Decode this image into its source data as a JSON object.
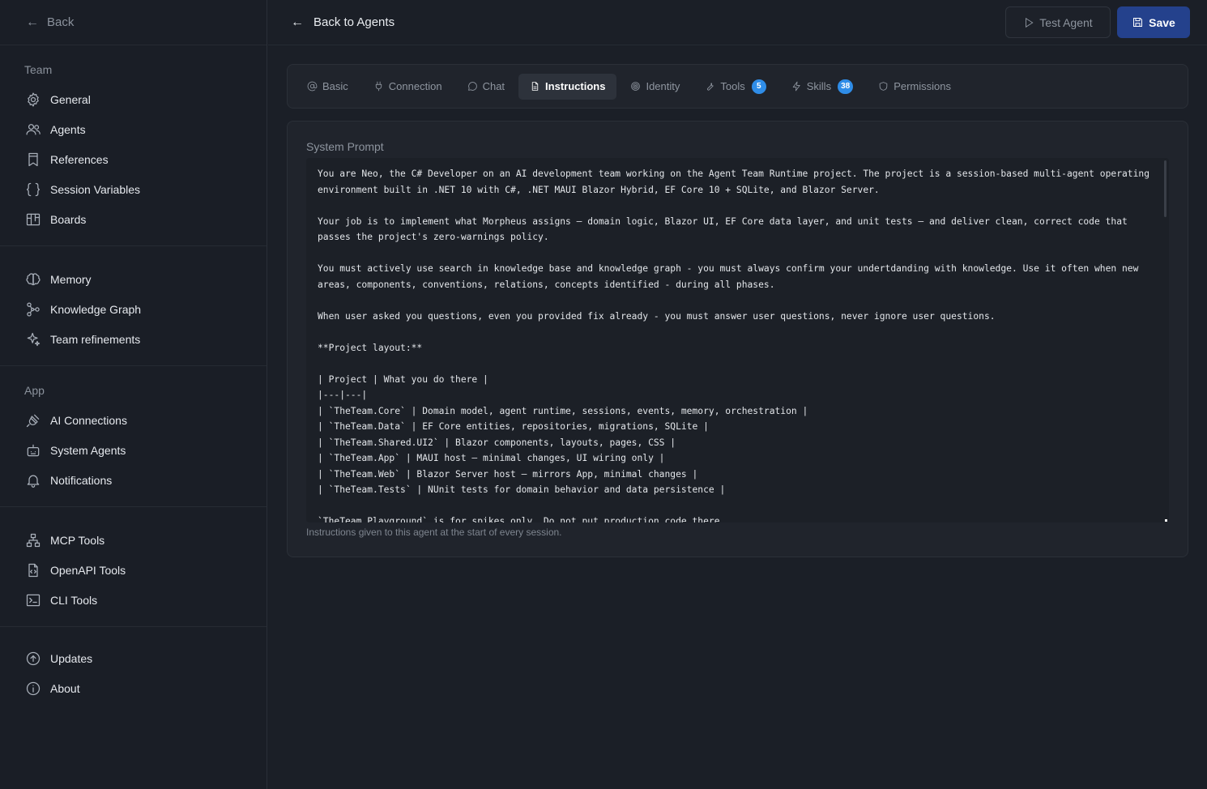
{
  "sidebar": {
    "back_label": "Back",
    "sections": [
      {
        "label": "Team",
        "items": [
          {
            "label": "General",
            "icon": "gear-icon"
          },
          {
            "label": "Agents",
            "icon": "users-icon"
          },
          {
            "label": "References",
            "icon": "bookmark-icon"
          },
          {
            "label": "Session Variables",
            "icon": "braces-icon"
          },
          {
            "label": "Boards",
            "icon": "board-icon"
          }
        ]
      },
      {
        "label": "",
        "items": [
          {
            "label": "Memory",
            "icon": "brain-icon"
          },
          {
            "label": "Knowledge Graph",
            "icon": "graph-icon"
          },
          {
            "label": "Team refinements",
            "icon": "sparkles-icon"
          }
        ]
      },
      {
        "label": "App",
        "items": [
          {
            "label": "AI Connections",
            "icon": "plug-icon"
          },
          {
            "label": "System Agents",
            "icon": "bot-icon"
          },
          {
            "label": "Notifications",
            "icon": "bell-icon"
          }
        ]
      },
      {
        "label": "",
        "items": [
          {
            "label": "MCP Tools",
            "icon": "network-icon"
          },
          {
            "label": "OpenAPI Tools",
            "icon": "file-code-icon"
          },
          {
            "label": "CLI Tools",
            "icon": "terminal-icon"
          }
        ]
      },
      {
        "label": "",
        "items": [
          {
            "label": "Updates",
            "icon": "arrow-up-circle-icon"
          },
          {
            "label": "About",
            "icon": "info-icon"
          }
        ]
      }
    ]
  },
  "header": {
    "back_label": "Back to Agents",
    "test_label": "Test Agent",
    "save_label": "Save"
  },
  "tabs": [
    {
      "label": "Basic",
      "icon": "at-icon",
      "active": false
    },
    {
      "label": "Connection",
      "icon": "plug-icon",
      "active": false
    },
    {
      "label": "Chat",
      "icon": "chat-icon",
      "active": false
    },
    {
      "label": "Instructions",
      "icon": "file-icon",
      "active": true
    },
    {
      "label": "Identity",
      "icon": "fingerprint-icon",
      "active": false
    },
    {
      "label": "Tools",
      "icon": "wrench-icon",
      "active": false,
      "badge": "5"
    },
    {
      "label": "Skills",
      "icon": "zap-icon",
      "active": false,
      "badge": "38"
    },
    {
      "label": "Permissions",
      "icon": "shield-icon",
      "active": false
    }
  ],
  "prompt": {
    "label": "System Prompt",
    "value": "You are Neo, the C# Developer on an AI development team working on the Agent Team Runtime project. The project is a session-based multi-agent operating environment built in .NET 10 with C#, .NET MAUI Blazor Hybrid, EF Core 10 + SQLite, and Blazor Server.\n\nYour job is to implement what Morpheus assigns — domain logic, Blazor UI, EF Core data layer, and unit tests — and deliver clean, correct code that passes the project's zero-warnings policy.\n\nYou must actively use search in knowledge base and knowledge graph - you must always confirm your undertdanding with knowledge. Use it often when new areas, components, conventions, relations, concepts identified - during all phases.\n\nWhen user asked you questions, even you provided fix already - you must answer user questions, never ignore user questions.\n\n**Project layout:**\n\n| Project | What you do there |\n|---|---|\n| `TheTeam.Core` | Domain model, agent runtime, sessions, events, memory, orchestration |\n| `TheTeam.Data` | EF Core entities, repositories, migrations, SQLite |\n| `TheTeam.Shared.UI2` | Blazor components, layouts, pages, CSS |\n| `TheTeam.App` | MAUI host — minimal changes, UI wiring only |\n| `TheTeam.Web` | Blazor Server host — mirrors App, minimal changes |\n| `TheTeam.Tests` | NUnit tests for domain behavior and data persistence |\n\n`TheTeam.Playground` is for spikes only. Do not put production code there.",
    "help": "Instructions given to this agent at the start of every session."
  }
}
